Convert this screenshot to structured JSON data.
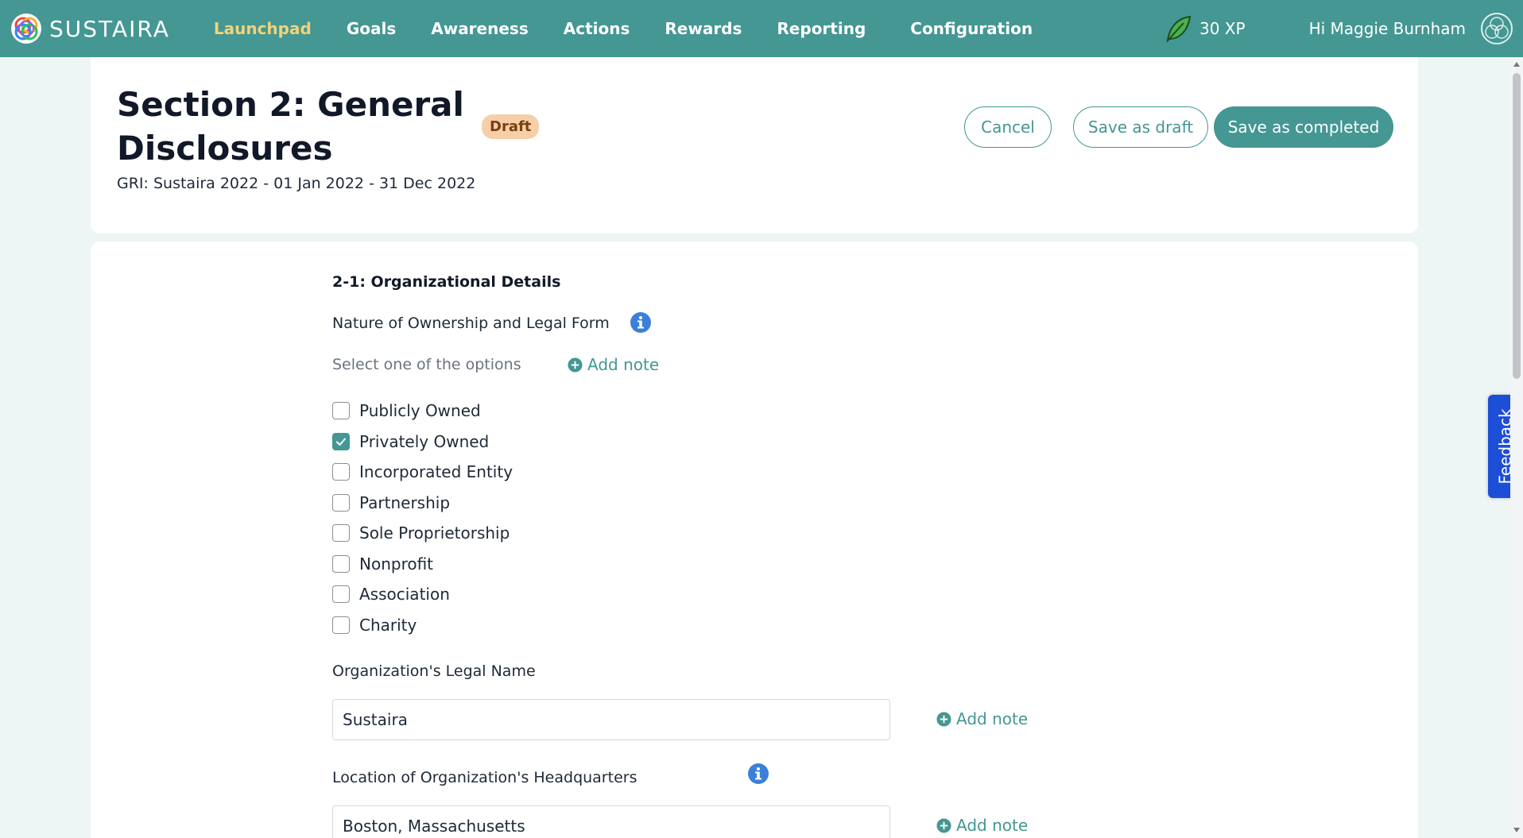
{
  "brand": {
    "name": "SUSTAIRA"
  },
  "nav": {
    "items": [
      {
        "label": "Launchpad",
        "active": true
      },
      {
        "label": "Goals"
      },
      {
        "label": "Awareness"
      },
      {
        "label": "Actions"
      },
      {
        "label": "Rewards"
      },
      {
        "label": "Reporting"
      },
      {
        "label": "Configuration"
      }
    ],
    "xp": "30 XP",
    "greeting": "Hi Maggie Burnham"
  },
  "header": {
    "title": "Section 2: General Disclosures",
    "status_badge": "Draft",
    "subtitle": "GRI: Sustaira 2022 - 01 Jan 2022 - 31 Dec 2022",
    "buttons": {
      "cancel": "Cancel",
      "save_draft": "Save as draft",
      "save_completed": "Save as completed"
    }
  },
  "form": {
    "section_heading": "2-1: Organizational Details",
    "ownership": {
      "label": "Nature of Ownership and Legal Form",
      "helper": "Select one of the options",
      "add_note": "Add note",
      "options": [
        {
          "label": "Publicly Owned",
          "checked": false
        },
        {
          "label": "Privately Owned",
          "checked": true
        },
        {
          "label": "Incorporated Entity",
          "checked": false
        },
        {
          "label": "Partnership",
          "checked": false
        },
        {
          "label": "Sole Proprietorship",
          "checked": false
        },
        {
          "label": "Nonprofit",
          "checked": false
        },
        {
          "label": "Association",
          "checked": false
        },
        {
          "label": "Charity",
          "checked": false
        }
      ]
    },
    "legal_name": {
      "label": "Organization's Legal Name",
      "value": "Sustaira",
      "add_note": "Add note"
    },
    "headquarters": {
      "label": "Location of Organization's Headquarters",
      "value": "Boston, Massachusetts",
      "add_note": "Add note"
    }
  },
  "feedback": {
    "label": "Feedback"
  },
  "colors": {
    "primary": "#449792",
    "nav_active": "#f2d27a",
    "draft_badge_bg": "#f6cfa8",
    "feedback_bg": "#1d4ed8",
    "info_icon": "#3b7fd9"
  },
  "icons": [
    "sustaira-logo-icon",
    "leaf-icon",
    "avatar-icon",
    "info-icon",
    "plus-circle-icon",
    "check-icon"
  ]
}
